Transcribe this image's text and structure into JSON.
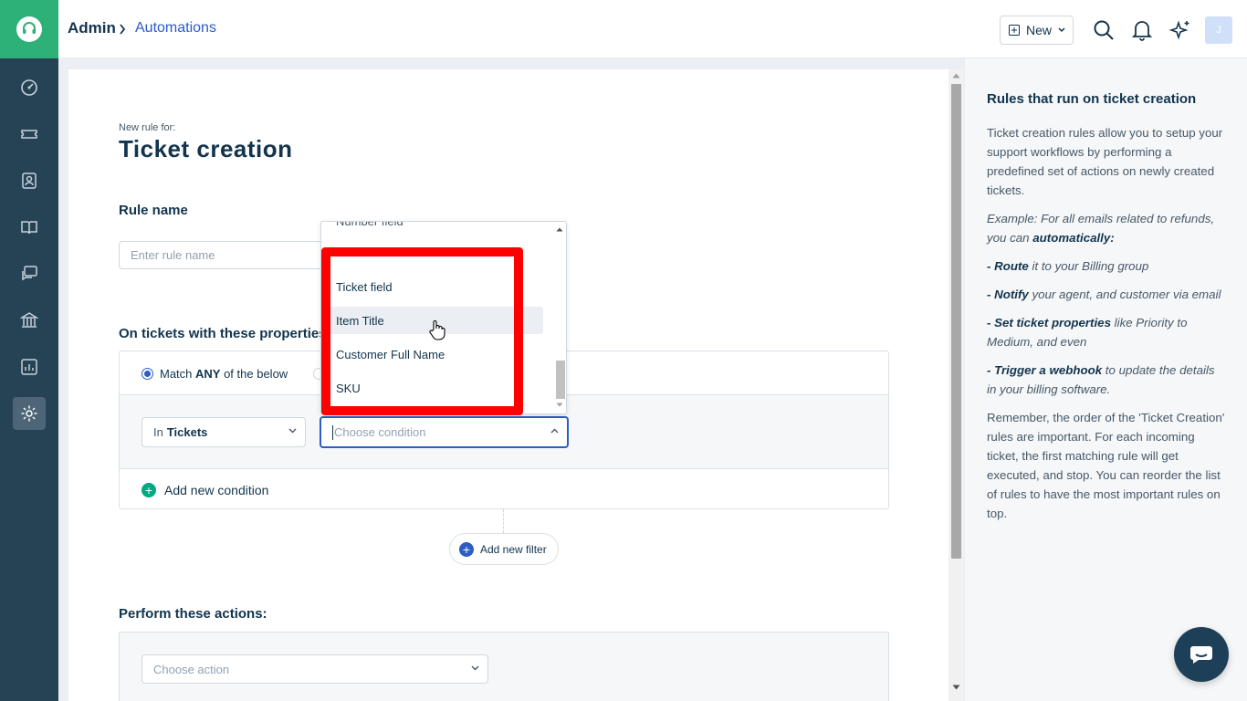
{
  "breadcrumb": {
    "admin": "Admin",
    "current": "Automations"
  },
  "header": {
    "new_label": "New",
    "avatar_initial": "J"
  },
  "rule": {
    "subtitle": "New rule for:",
    "title": "Ticket creation",
    "rule_name_label": "Rule name",
    "rule_name_placeholder": "Enter rule name",
    "conditions_label": "On tickets with these properties",
    "match_prefix": "Match ",
    "match_strong": "ANY",
    "match_suffix": " of the below",
    "in_prefix": "In",
    "in_value": "Tickets",
    "condition_placeholder": "Choose condition",
    "add_condition": "Add new condition",
    "add_filter": "Add new filter",
    "actions_label": "Perform these actions:",
    "action_placeholder": "Choose action"
  },
  "dropdown": {
    "clipped_top": "Number field",
    "items": [
      "Ticket field",
      "Item Title",
      "Customer Full Name",
      "SKU"
    ],
    "hovered_index": 1
  },
  "help": {
    "title": "Rules that run on ticket creation",
    "intro": "Ticket creation rules allow you to setup your support workflows by performing a predefined set of actions on newly created tickets.",
    "example_prefix": "Example: For all emails related to refunds, you can ",
    "example_strong": "automatically:",
    "bullets": [
      {
        "strong": "- Route",
        "rest": " it to your Billing group"
      },
      {
        "strong": "- Notify",
        "rest": " your agent, and customer via email"
      },
      {
        "strong": "- Set ticket properties",
        "rest": " like Priority to Medium, and even"
      },
      {
        "strong": "- Trigger a webhook",
        "rest": " to update the details in your billing software."
      }
    ],
    "outro": "Remember, the order of the 'Ticket Creation' rules are important. For each incoming ticket, the first matching rule will get executed, and stop. You can reorder the list of rules to have the most important rules on top."
  },
  "colors": {
    "nav_bg": "#264356",
    "brand_green": "#2db178",
    "accent_blue": "#2c5cc5",
    "highlight_red": "#ff0000"
  },
  "icons": [
    "headset-logo-icon",
    "dashboard-icon",
    "ticket-icon",
    "contact-icon",
    "book-icon",
    "chat-icon",
    "bank-icon",
    "reports-icon",
    "settings-icon",
    "search-icon",
    "bell-icon",
    "ai-sparkle-icon",
    "chat-widget-icon"
  ]
}
